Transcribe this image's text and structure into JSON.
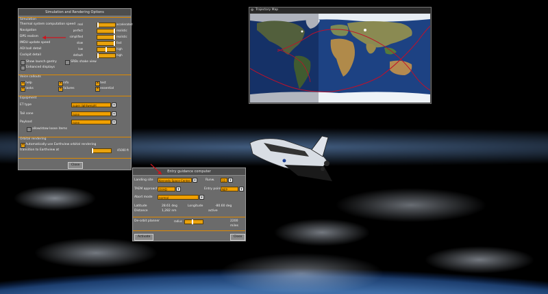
{
  "sim_window": {
    "title": "Simulation and Rendering Options",
    "simulation": {
      "header": "Simulation",
      "rows": [
        {
          "label": "Thermal system computation speed",
          "lo": "real",
          "hi": "accelerated"
        },
        {
          "label": "Navigation",
          "lo": "perfect",
          "hi": "realistic"
        },
        {
          "label": "DPS realism",
          "lo": "simplified",
          "hi": "realistic"
        },
        {
          "label": "IMDU update speed",
          "lo": "slow",
          "hi": "fast"
        },
        {
          "label": "ADI ball detail",
          "lo": "low",
          "hi": "high"
        },
        {
          "label": "Cockpit detail",
          "lo": "default",
          "hi": "high"
        }
      ],
      "show_launch_gantry": "Show launch gantry",
      "sbbs_shake_view": "SRBs shake view",
      "enhanced_displays": "Enhanced displays"
    },
    "voice": {
      "header": "Voice callouts",
      "items": [
        "help",
        "info",
        "test",
        "tasks",
        "failures",
        "essential"
      ]
    },
    "equipment": {
      "header": "Equipment",
      "et_type_label": "ET type",
      "et_type_value": "super lightweight",
      "tail_cone_label": "Tail cone",
      "tail_cone_value": "none",
      "payload_label": "Payload",
      "payload_value": "none",
      "allow_loose_items": "allow/stow loose items"
    },
    "orbital": {
      "header": "Orbital rendering",
      "auto_earthview": "Automatically use Earthview orbital rendering",
      "transition_label": "transition to Earthview at",
      "transition_value": "45000 ft"
    },
    "close": "Close"
  },
  "map_window": {
    "title": "Trajectory Map"
  },
  "entry_window": {
    "title": "Entry guidance computer",
    "landing_site_label": "Landing site",
    "landing_site_value": "Kennedy Space Center",
    "runway_label": "Runw.",
    "runway_value": "15",
    "taem_label": "TAEM approach",
    "taem_value": "OVHD",
    "entry_point_label": "Entry point",
    "entry_point_value": "NEP",
    "abort_label": "Abort mode",
    "abort_value": "normal",
    "latitude_label": "Latitude",
    "latitude_value": "28.61 deg",
    "longitude_label": "Longitude",
    "longitude_value": "-80.60 deg",
    "distance_label": "Distance",
    "distance_value": "1,282 nm",
    "status_value": "active",
    "deorbit_label": "De-orbit planner",
    "deorbit_lo": "radius",
    "deorbit_value": "2200 miles",
    "activate": "Activate",
    "close": "Close"
  },
  "colors": {
    "accent": "#e9a20c",
    "window_bg": "#6b6b6b",
    "trajectory": "#c0102a"
  }
}
